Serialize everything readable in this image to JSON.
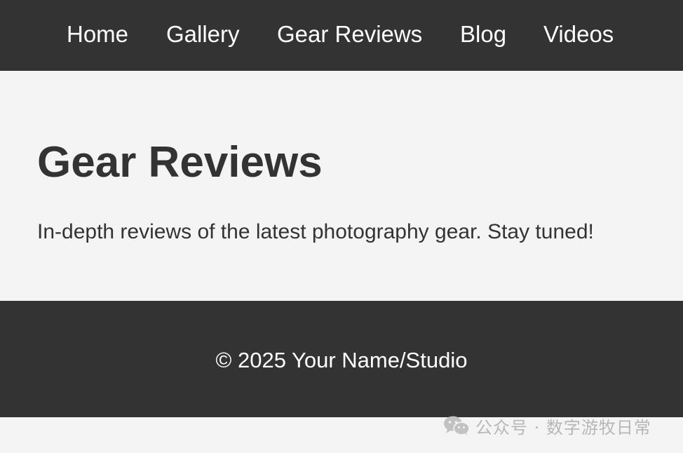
{
  "nav": {
    "items": [
      {
        "label": "Home"
      },
      {
        "label": "Gallery"
      },
      {
        "label": "Gear Reviews"
      },
      {
        "label": "Blog"
      },
      {
        "label": "Videos"
      }
    ]
  },
  "main": {
    "title": "Gear Reviews",
    "description": "In-depth reviews of the latest photography gear. Stay tuned!"
  },
  "footer": {
    "copyright": "© 2025 Your Name/Studio"
  },
  "watermark": {
    "icon": "wechat-icon",
    "text": "公众号 · 数字游牧日常"
  },
  "colors": {
    "bar": "#333333",
    "page_background": "#f4f4f4",
    "text_dark": "#333333",
    "text_light": "#ffffff",
    "watermark": "#b7b7b7"
  }
}
